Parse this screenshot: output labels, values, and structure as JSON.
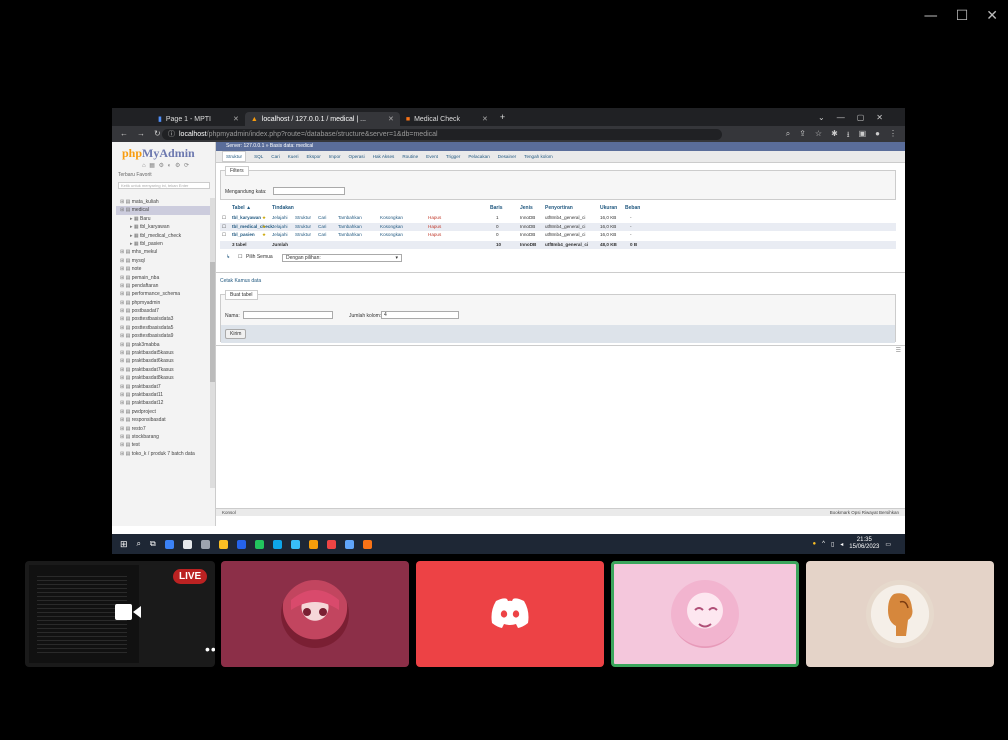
{
  "window": {
    "controls": [
      "—",
      "☐",
      "✕"
    ]
  },
  "browser": {
    "tabs": [
      {
        "label": "Page 1 - MPTI"
      },
      {
        "label": "localhost / 127.0.0.1 / medical | ..."
      },
      {
        "label": "Medical Check"
      }
    ],
    "new_tab": "+",
    "url_host": "localhost",
    "url_path": "/phpmyadmin/index.php?route=/database/structure&server=1&db=medical"
  },
  "pma": {
    "logo_php": "php",
    "logo_my": "MyAdmin",
    "side_tabs": "Terbaru  Favorit",
    "side_search_placeholder": "Ketik untuk menyaring ini, tekan Enter",
    "databases": [
      {
        "label": "mata_kuliah",
        "sel": false,
        "sub": false
      },
      {
        "label": "medical",
        "sel": true,
        "sub": false
      },
      {
        "label": "Baru",
        "sel": false,
        "sub": true
      },
      {
        "label": "tbl_karyawan",
        "sel": false,
        "sub": true
      },
      {
        "label": "tbl_medical_check",
        "sel": false,
        "sub": true
      },
      {
        "label": "tbl_pasien",
        "sel": false,
        "sub": true
      },
      {
        "label": "mhs_mekul",
        "sel": false,
        "sub": false
      },
      {
        "label": "mysql",
        "sel": false,
        "sub": false
      },
      {
        "label": "note",
        "sel": false,
        "sub": false
      },
      {
        "label": "pemain_nba",
        "sel": false,
        "sub": false
      },
      {
        "label": "pendaftaran",
        "sel": false,
        "sub": false
      },
      {
        "label": "performance_schema",
        "sel": false,
        "sub": false
      },
      {
        "label": "phpmyadmin",
        "sel": false,
        "sub": false
      },
      {
        "label": "postbasdat7",
        "sel": false,
        "sub": false
      },
      {
        "label": "posttestbasisdata3",
        "sel": false,
        "sub": false
      },
      {
        "label": "posttestbasisdata5",
        "sel": false,
        "sub": false
      },
      {
        "label": "posttestbasisdata9",
        "sel": false,
        "sub": false
      },
      {
        "label": "prak3mabba",
        "sel": false,
        "sub": false
      },
      {
        "label": "praktbasdat5kasus",
        "sel": false,
        "sub": false
      },
      {
        "label": "praktbasdat6kasus",
        "sel": false,
        "sub": false
      },
      {
        "label": "praktbasdat7kasus",
        "sel": false,
        "sub": false
      },
      {
        "label": "praktbasdat8kasus",
        "sel": false,
        "sub": false
      },
      {
        "label": "praktbasdat7",
        "sel": false,
        "sub": false
      },
      {
        "label": "praktbasdat11",
        "sel": false,
        "sub": false
      },
      {
        "label": "praktbasdat12",
        "sel": false,
        "sub": false
      },
      {
        "label": "pwdproject",
        "sel": false,
        "sub": false
      },
      {
        "label": "responsibasdat",
        "sel": false,
        "sub": false
      },
      {
        "label": "resto7",
        "sel": false,
        "sub": false
      },
      {
        "label": "stockbarang",
        "sel": false,
        "sub": false
      },
      {
        "label": "test",
        "sel": false,
        "sub": false
      },
      {
        "label": "toko_k / produk 7 batch data",
        "sel": false,
        "sub": false
      }
    ],
    "breadcrumb": "Server: 127.0.0.1 » Basis data: medical",
    "tabs": [
      "Struktur",
      "SQL",
      "Cari",
      "Kueri",
      "Ekspor",
      "Impor",
      "Operasi",
      "Hak Akses",
      "Routine",
      "Event",
      "Trigger",
      "Pelacakan",
      "Desainer",
      "Tengah kolom"
    ],
    "filters_legend": "Filters",
    "filter_label": "Mengandung kata:",
    "table_headers": {
      "tabel": "Tabel ▲",
      "tindakan": "Tindakan",
      "baris": "Baris",
      "jenis": "Jenis",
      "penyortiran": "Penyortiran",
      "ukuran": "Ukuran",
      "beban": "Beban"
    },
    "actions": [
      "Jelajahi",
      "Struktur",
      "Cari",
      "Tambahkan",
      "Kosongkan",
      "Hapus"
    ],
    "rows": [
      {
        "name": "tbl_karyawan",
        "rows": "1",
        "type": "InnoDB",
        "collation": "utf8mb4_general_ci",
        "size": "16,0 KB",
        "overhead": "-"
      },
      {
        "name": "tbl_medical_check",
        "rows": "0",
        "type": "InnoDB",
        "collation": "utf8mb4_general_ci",
        "size": "16,0 KB",
        "overhead": "-"
      },
      {
        "name": "tbl_pasien",
        "rows": "0",
        "type": "InnoDB",
        "collation": "utf8mb4_general_ci",
        "size": "16,0 KB",
        "overhead": "-"
      }
    ],
    "summary": {
      "count": "3 tabel",
      "label": "Jumlah",
      "rows": "10",
      "type": "InnoDB",
      "collation": "utf8mb4_general_ci",
      "size": "48,0 KB",
      "overhead": "0 B"
    },
    "check_all": "Pilih Semua",
    "with_selected": "Dengan pilihan:",
    "print_links": "Cetak  Kamus data",
    "create_legend": "Buat tabel",
    "name_label": "Nama:",
    "cols_label": "Jumlah kolom:",
    "cols_value": "4",
    "submit": "Kirim",
    "console": "Konsol",
    "bottom_right": "Bookmark  Opsi  Riwayat  Bersihkan"
  },
  "taskbar": {
    "time": "21:35",
    "date": "15/06/2023",
    "icon_colors": [
      "#3b82f6",
      "#e5e7eb",
      "#9ca3af",
      "#fbbf24",
      "#2563eb",
      "#22c55e",
      "#0ea5e9",
      "#38bdf8",
      "#f59e0b",
      "#ef4444",
      "#60a5fa",
      "#f97316"
    ]
  },
  "call": {
    "live_label": "LIVE",
    "more": "•••",
    "accent_discord": "#ed4245",
    "speaking_border": "#3ba55c"
  }
}
